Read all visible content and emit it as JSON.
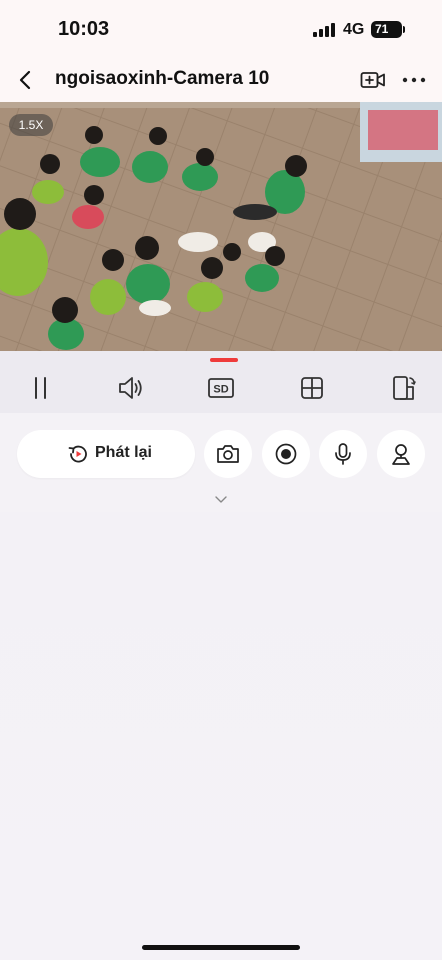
{
  "status_bar": {
    "time": "10:03",
    "network": "4G",
    "battery": "71"
  },
  "header": {
    "title": "ngoisaoxinh-Camera 10",
    "back_icon": "chevron-left-icon",
    "add_icon": "video-add-icon",
    "more_icon": "more-horizontal-icon"
  },
  "video": {
    "zoom_label": "1.5X"
  },
  "controls": {
    "items": [
      "pause-icon",
      "speaker-icon",
      "sd-quality-icon",
      "grid-layout-icon",
      "rotate-screen-icon"
    ],
    "sd_label": "SD"
  },
  "actions": {
    "playback_label": "Phát lại",
    "buttons": [
      "snapshot-camera-icon",
      "record-icon",
      "microphone-icon",
      "ptz-person-icon"
    ]
  },
  "colors": {
    "accent": "#ef3b3b",
    "background": "#f4f2f6",
    "control_bar": "#eceaf0"
  }
}
